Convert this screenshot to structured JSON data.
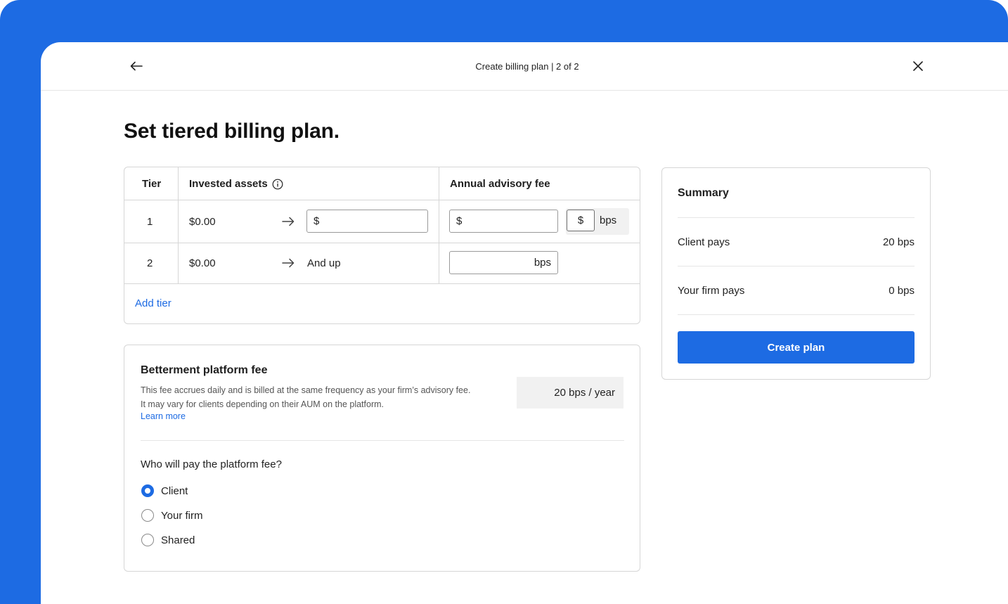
{
  "header": {
    "step_title": "Create billing plan | 2 of 2",
    "back_icon": "arrow-left-icon",
    "close_icon": "close-icon"
  },
  "page_title": "Set tiered billing plan.",
  "tier_table": {
    "headers": {
      "tier": "Tier",
      "invested_assets": "Invested assets",
      "annual_fee": "Annual advisory fee"
    },
    "info_icon": "info-icon",
    "rows": [
      {
        "tier": "1",
        "from": "$0.00",
        "to_placeholder": "$",
        "fee_placeholder": "$",
        "unit_options": [
          "$",
          "bps"
        ]
      },
      {
        "tier": "2",
        "from": "$0.00",
        "to_text": "And up",
        "fee_unit": "bps"
      }
    ],
    "add_tier_label": "Add tier"
  },
  "platform_fee": {
    "title": "Betterment platform fee",
    "description": "This fee accrues daily and is billed at the same frequency as your firm’s advisory fee. It may vary for clients depending on their AUM on the platform.",
    "learn_more": "Learn more",
    "fee_value": "20 bps / year",
    "question": "Who will pay the platform fee?",
    "options": [
      {
        "label": "Client",
        "selected": true
      },
      {
        "label": "Your firm",
        "selected": false
      },
      {
        "label": "Shared",
        "selected": false
      }
    ]
  },
  "summary": {
    "title": "Summary",
    "client_pays_label": "Client pays",
    "client_pays_value": "20 bps",
    "firm_pays_label": "Your firm pays",
    "firm_pays_value": "0 bps",
    "create_button": "Create plan"
  },
  "colors": {
    "brand_blue": "#1d6be3",
    "border": "#d6d6d6",
    "muted_bg": "#f1f1f1"
  }
}
